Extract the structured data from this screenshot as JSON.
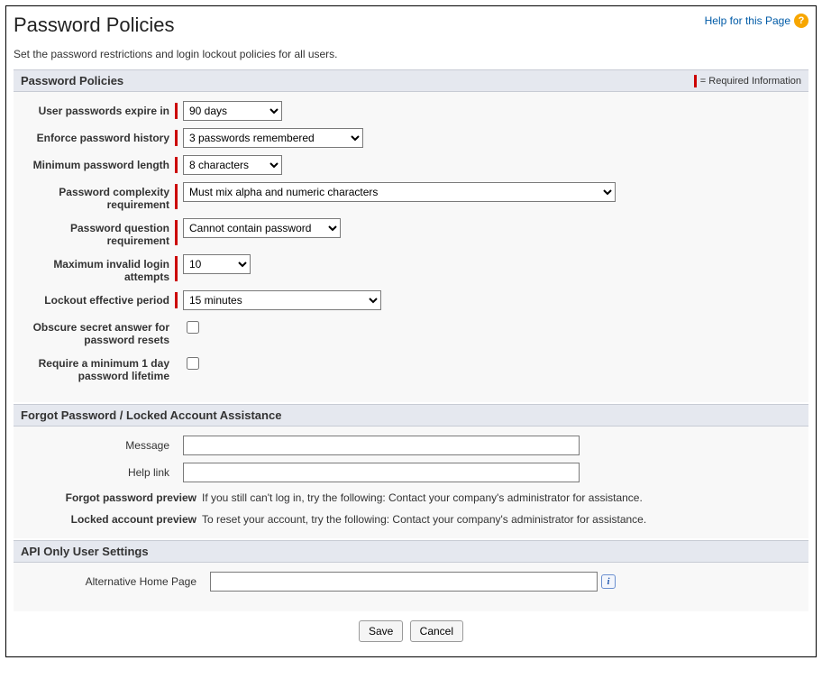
{
  "page": {
    "title": "Password Policies",
    "description": "Set the password restrictions and login lockout policies for all users.",
    "help_link": "Help for this Page"
  },
  "sections": {
    "policies": {
      "title": "Password Policies",
      "required_note": "= Required Information"
    },
    "forgot": {
      "title": "Forgot Password / Locked Account Assistance"
    },
    "api": {
      "title": "API Only User Settings"
    }
  },
  "fields": {
    "expire": {
      "label": "User passwords expire in",
      "value": "90 days"
    },
    "history": {
      "label": "Enforce password history",
      "value": "3 passwords remembered"
    },
    "minlen": {
      "label": "Minimum password length",
      "value": "8 characters"
    },
    "complexity": {
      "label": "Password complexity requirement",
      "value": "Must mix alpha and numeric characters"
    },
    "question": {
      "label": "Password question requirement",
      "value": "Cannot contain password"
    },
    "maxinvalid": {
      "label": "Maximum invalid login attempts",
      "value": "10"
    },
    "lockout": {
      "label": "Lockout effective period",
      "value": "15 minutes"
    },
    "obscure": {
      "label": "Obscure secret answer for password resets"
    },
    "min1day": {
      "label": "Require a minimum 1 day password lifetime"
    },
    "message": {
      "label": "Message",
      "value": ""
    },
    "helplink": {
      "label": "Help link",
      "value": ""
    },
    "forgot_preview": {
      "label": "Forgot password preview",
      "text": "If you still can't log in, try the following: Contact your company's administrator for assistance."
    },
    "locked_preview": {
      "label": "Locked account preview",
      "text": "To reset your account, try the following: Contact your company's administrator for assistance."
    },
    "althome": {
      "label": "Alternative Home Page",
      "value": ""
    }
  },
  "buttons": {
    "save": "Save",
    "cancel": "Cancel"
  }
}
